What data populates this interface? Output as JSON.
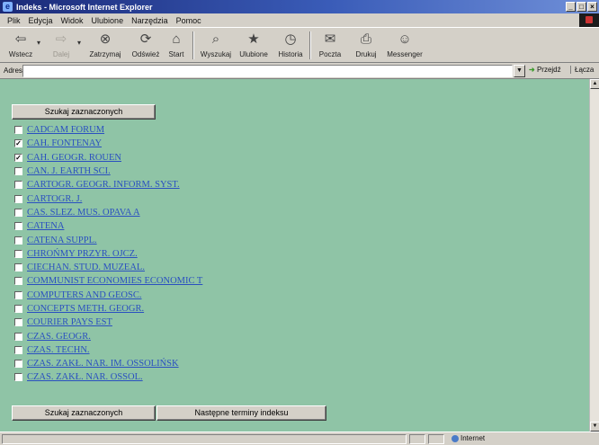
{
  "window": {
    "title": "Indeks - Microsoft Internet Explorer"
  },
  "menu": [
    "Plik",
    "Edycja",
    "Widok",
    "Ulubione",
    "Narzędzia",
    "Pomoc"
  ],
  "toolbar": {
    "back": "Wstecz",
    "forward": "Dalej",
    "stop": "Zatrzymaj",
    "refresh": "Odśwież",
    "home": "Start",
    "search": "Wyszukaj",
    "favorites": "Ulubione",
    "history": "Historia",
    "mail": "Poczta",
    "print": "Drukuj",
    "messenger": "Messenger"
  },
  "address": {
    "label": "Adres",
    "value": "",
    "go": "Przejdź",
    "links": "Łącza"
  },
  "buttons": {
    "search_selected": "Szukaj zaznaczonych",
    "next_terms": "Następne terminy indeksu"
  },
  "index_items": [
    {
      "label": "CADCAM FORUM",
      "checked": false
    },
    {
      "label": "CAH. FONTENAY",
      "checked": true
    },
    {
      "label": "CAH. GEOGR. ROUEN",
      "checked": true
    },
    {
      "label": "CAN. J. EARTH SCI.",
      "checked": false
    },
    {
      "label": "CARTOGR. GEOGR. INFORM. SYST.",
      "checked": false
    },
    {
      "label": "CARTOGR. J.",
      "checked": false
    },
    {
      "label": "CAS. SLEZ. MUS. OPAVA A",
      "checked": false
    },
    {
      "label": "CATENA",
      "checked": false
    },
    {
      "label": "CATENA SUPPL.",
      "checked": false
    },
    {
      "label": "CHROŃMY PRZYR. OJCZ.",
      "checked": false
    },
    {
      "label": "CIECHAN. STUD. MUZEAL.",
      "checked": false
    },
    {
      "label": "COMMUNIST ECONOMIES ECONOMIC T",
      "checked": false
    },
    {
      "label": "COMPUTERS AND GEOSC.",
      "checked": false
    },
    {
      "label": "CONCEPTS METH. GEOGR.",
      "checked": false
    },
    {
      "label": "COURIER PAYS EST",
      "checked": false
    },
    {
      "label": "CZAS. GEOGR.",
      "checked": false
    },
    {
      "label": "CZAS. TECHN.",
      "checked": false
    },
    {
      "label": "CZAS. ZAKŁ. NAR. IM. OSSOLIŃSK",
      "checked": false
    },
    {
      "label": "CZAS. ZAKŁ. NAR. OSSOL.",
      "checked": false
    }
  ],
  "status": {
    "zone": "Internet"
  },
  "colors": {
    "page_background": "#8fc4a6",
    "link": "#2a50c0",
    "titlebar": "#1b2a78"
  }
}
